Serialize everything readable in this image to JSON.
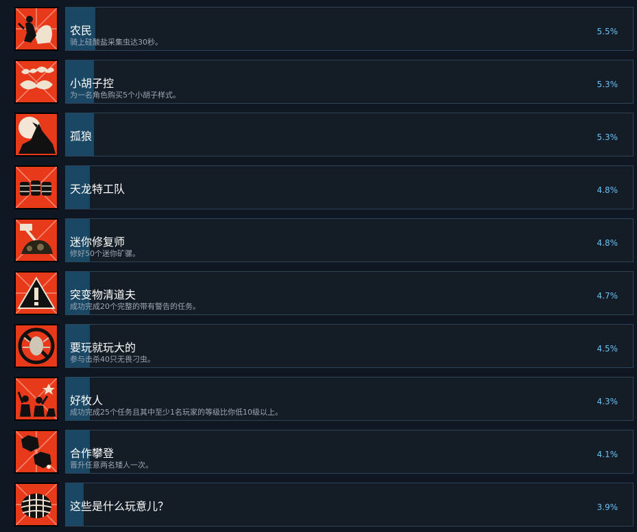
{
  "achievements": [
    {
      "title": "农民",
      "desc": "骑上硅酸盐采集虫达30秒。",
      "percent": "5.5%",
      "fill": 0.055,
      "icon": "rider-icon"
    },
    {
      "title": "小胡子控",
      "desc": "为一名角色购买5个小胡子样式。",
      "percent": "5.3%",
      "fill": 0.053,
      "icon": "mustache-icon"
    },
    {
      "title": "孤狼",
      "desc": "",
      "percent": "5.3%",
      "fill": 0.053,
      "icon": "howling-wolf-icon"
    },
    {
      "title": "天龙特工队",
      "desc": "",
      "percent": "4.8%",
      "fill": 0.048,
      "icon": "barrels-icon"
    },
    {
      "title": "迷你修复师",
      "desc": "修好50个迷你矿骡。",
      "percent": "4.8%",
      "fill": 0.048,
      "icon": "hammer-repair-icon"
    },
    {
      "title": "突变物清道夫",
      "desc": "成功完成20个完整的带有警告的任务。",
      "percent": "4.7%",
      "fill": 0.047,
      "icon": "warning-icon"
    },
    {
      "title": "要玩就玩大的",
      "desc": "参与击杀40只无畏刁虫。",
      "percent": "4.5%",
      "fill": 0.045,
      "icon": "banned-bug-icon"
    },
    {
      "title": "好牧人",
      "desc": "成功完成25个任务且其中至少1名玩家的等级比你低10级以上。",
      "percent": "4.3%",
      "fill": 0.043,
      "icon": "dwarves-cheering-icon"
    },
    {
      "title": "合作攀登",
      "desc": "晋升任意两名矮人一次。",
      "percent": "4.1%",
      "fill": 0.041,
      "icon": "hexagon-stones-icon"
    },
    {
      "title": "这些是什么玩意儿？",
      "desc": "",
      "percent": "3.9%",
      "fill": 0.039,
      "icon": "barrel-icon"
    }
  ]
}
